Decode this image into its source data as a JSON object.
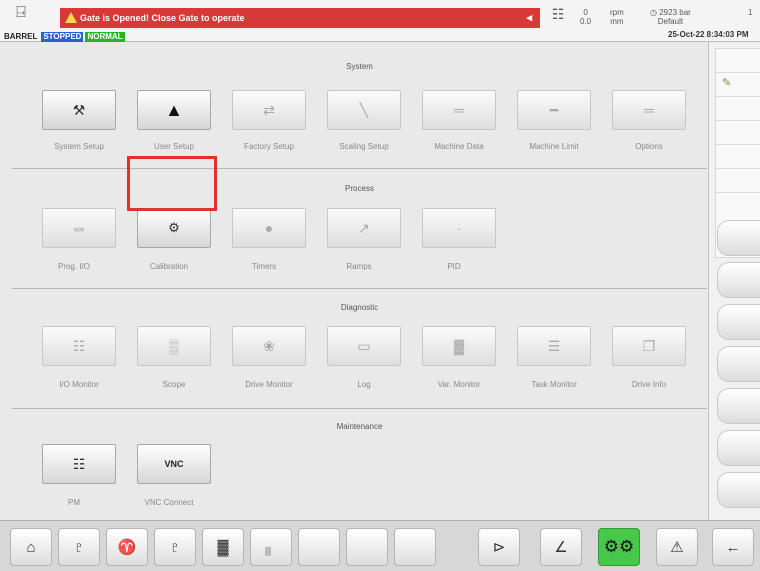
{
  "topbar": {
    "alarm_text": "Gate is Opened! Close Gate to operate",
    "status_label": "BARREL",
    "status_state": "STOPPED",
    "status_mode": "NORMAL",
    "readout_1": "0",
    "readout_1b": "0.0",
    "readout_2": "rpm",
    "readout_2b": "mm",
    "readout_3": "2923",
    "readout_3b": "bar",
    "readout_4": "Default",
    "readout_5": "1",
    "datetime": "25-Oct-22 8:34:03 PM"
  },
  "sections": {
    "system": "System",
    "process": "Process",
    "diagnostic": "Diagnostic",
    "maintenance": "Maintenance"
  },
  "system_buttons": [
    {
      "label": "System Setup",
      "icon": "wrench-icon"
    },
    {
      "label": "User Setup",
      "icon": "user-icon"
    },
    {
      "label": "Factory Setup",
      "icon": "factory-icon"
    },
    {
      "label": "Scaling Setup",
      "icon": "scaling-icon"
    },
    {
      "label": "Machine Data",
      "icon": "machine-data-icon"
    },
    {
      "label": "Machine Limit",
      "icon": "machine-limit-icon"
    },
    {
      "label": "Options",
      "icon": "options-icon"
    }
  ],
  "process_buttons": [
    {
      "label": "Prog. I/O",
      "icon": "prog-io-icon"
    },
    {
      "label": "Calibration",
      "icon": "calibration-icon"
    },
    {
      "label": "Timers",
      "icon": "timer-icon"
    },
    {
      "label": "Ramps",
      "icon": "ramp-icon"
    },
    {
      "label": "PID",
      "icon": "pid-icon"
    }
  ],
  "diagnostic_buttons": [
    {
      "label": "I/O Monitor",
      "icon": "io-monitor-icon"
    },
    {
      "label": "Scope",
      "icon": "scope-icon"
    },
    {
      "label": "Drive Monitor",
      "icon": "drive-monitor-icon"
    },
    {
      "label": "Log",
      "icon": "log-icon"
    },
    {
      "label": "Var. Monitor",
      "icon": "var-monitor-icon"
    },
    {
      "label": "Task Monitor",
      "icon": "task-monitor-icon"
    },
    {
      "label": "Drive Info",
      "icon": "drive-info-icon"
    }
  ],
  "maintenance_buttons": [
    {
      "label": "PM",
      "icon": "pm-icon"
    },
    {
      "label": "VNC Connect",
      "icon": "vnc-icon",
      "text": "VNC"
    }
  ],
  "colors": {
    "alarm": "#d83838",
    "stopped": "#2c5fd4",
    "normal": "#27b427",
    "active_nav": "#48c84b",
    "highlight": "#e0312d"
  }
}
